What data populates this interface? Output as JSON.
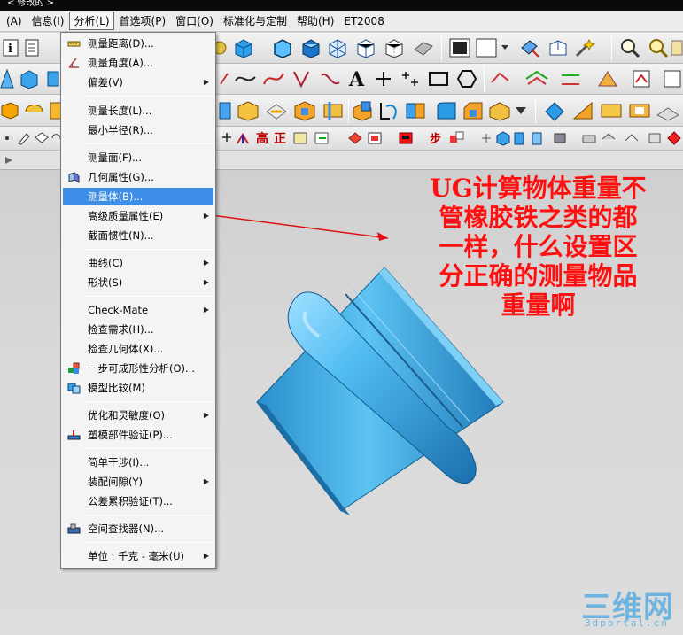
{
  "window": {
    "title": "< 修改的 >"
  },
  "menubar": {
    "items": [
      {
        "label": "(A)"
      },
      {
        "label": "信息(I)"
      },
      {
        "label": "分析(L)",
        "active": true
      },
      {
        "label": "首选项(P)"
      },
      {
        "label": "窗口(O)"
      },
      {
        "label": "标准化与定制"
      },
      {
        "label": "帮助(H)"
      },
      {
        "label": "ET2008"
      }
    ]
  },
  "analysis_menu": {
    "items": [
      {
        "label": "测量距离(D)...",
        "icon": "ruler-distance-icon"
      },
      {
        "label": "测量角度(A)...",
        "icon": "angle-icon"
      },
      {
        "label": "偏差(V)",
        "submenu": true
      },
      {
        "label": "测量长度(L)..."
      },
      {
        "label": "最小半径(R)..."
      },
      {
        "label": "测量面(F)..."
      },
      {
        "label": "几何属性(G)...",
        "icon": "geometry-props-icon"
      },
      {
        "label": "测量体(B)...",
        "highlighted": true
      },
      {
        "label": "高级质量属性(E)",
        "submenu": true
      },
      {
        "label": "截面惯性(N)..."
      },
      {
        "label": "曲线(C)",
        "submenu": true
      },
      {
        "label": "形状(S)",
        "submenu": true
      },
      {
        "label": "Check-Mate",
        "submenu": true
      },
      {
        "label": "检查需求(H)..."
      },
      {
        "label": "检查几何体(X)..."
      },
      {
        "label": "一步可成形性分析(O)...",
        "icon": "one-step-formability-icon"
      },
      {
        "label": "模型比较(M)",
        "icon": "model-compare-icon"
      },
      {
        "label": "优化和灵敏度(O)",
        "submenu": true
      },
      {
        "label": "塑模部件验证(P)...",
        "icon": "mold-validation-icon"
      },
      {
        "label": "简单干涉(I)..."
      },
      {
        "label": "装配间隙(Y)",
        "submenu": true
      },
      {
        "label": "公差累积验证(T)..."
      },
      {
        "label": "空间查找器(N)...",
        "icon": "spatial-search-icon"
      },
      {
        "label": "单位 : 千克 - 毫米(U)",
        "submenu": true
      }
    ]
  },
  "annotation": {
    "text": "UG计算物体重量不\n管橡胶铁之类的都\n一样，什么设置区\n分正确的测量物品\n重量啊"
  },
  "watermark": {
    "logo": "三维网",
    "url": "3dportal.cn"
  },
  "colors": {
    "highlight": "#3d8ee6",
    "annotation": "#ff1010",
    "model": "#4fb6e8",
    "watermark": "#6fb4e0"
  }
}
